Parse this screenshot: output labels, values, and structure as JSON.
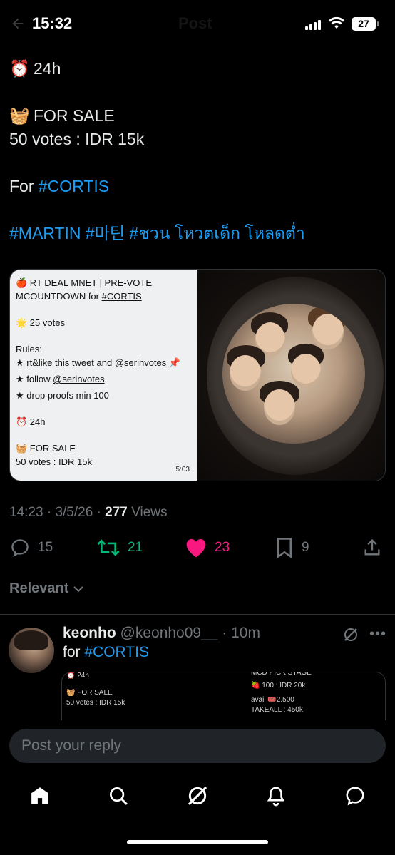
{
  "status_bar": {
    "time": "15:32",
    "ghost_title": "Post",
    "battery": "27"
  },
  "tweet": {
    "lines": [
      {
        "emoji": "⏰",
        "text": "24h"
      },
      {
        "emoji": "",
        "text": ""
      },
      {
        "emoji": "🧺",
        "text": "FOR SALE"
      },
      {
        "emoji": "",
        "text": "50 votes : IDR 15k"
      },
      {
        "emoji": "",
        "text": ""
      },
      {
        "emoji": "",
        "prefix": "For ",
        "tag": "#CORTIS"
      },
      {
        "emoji": "",
        "text": ""
      },
      {
        "emoji": "",
        "tags": "#MARTIN #마틴 #ชวน โหวตเด็ก โหลดต่ำ"
      }
    ],
    "media_note": {
      "line1": "🍎 RT DEAL MNET | PRE-VOTE",
      "line2_prefix": "MCOUNTDOWN for ",
      "line2_tag": "#CORTIS",
      "votes": "🌟 25 votes",
      "rules_title": "Rules:",
      "rule1_prefix": "★ rt&like this tweet and ",
      "rule1_handle": "@serinvotes",
      "rule1_suffix": " 📌",
      "rule2_prefix": "★ follow ",
      "rule2_handle": "@serinvotes",
      "rule3": "★ drop proofs min 100",
      "timer": "⏰ 24h",
      "sale": "🧺 FOR SALE",
      "price": "50 votes : IDR 15k",
      "stamp": "5:03"
    },
    "meta": {
      "time": "14:23",
      "date": "3/5/26",
      "views_count": "277",
      "views_label": "Views"
    },
    "actions": {
      "replies": "15",
      "reposts": "21",
      "likes": "23",
      "bookmarks": "9"
    }
  },
  "sort_label": "Relevant",
  "reply": {
    "name": "keonho",
    "handle": "@keonho09__",
    "age": "10m",
    "text_prefix": "for ",
    "text_tag": "#CORTIS",
    "media_left": [
      "⏰ 24h",
      "",
      "🧺 FOR SALE",
      "50 votes : IDR 15k"
    ],
    "media_right": [
      "MCD PICK STAGE",
      "",
      "🍓 100 : IDR 20k",
      "",
      "avail 🎟️2.500",
      "TAKEALL : 450k"
    ]
  },
  "composer": {
    "placeholder": "Post your reply"
  },
  "colors": {
    "link": "#1d9bf0",
    "repost": "#00ba7c",
    "like": "#f91880",
    "muted": "#71767b",
    "background": "#000000"
  },
  "icons": [
    "back-arrow-icon",
    "signal-icon",
    "wifi-icon",
    "battery-icon",
    "reply-icon",
    "repost-icon",
    "heart-icon",
    "bookmark-icon",
    "share-icon",
    "chevron-down-icon",
    "grok-icon",
    "more-icon",
    "home-icon",
    "search-icon",
    "notifications-icon",
    "messages-icon"
  ]
}
